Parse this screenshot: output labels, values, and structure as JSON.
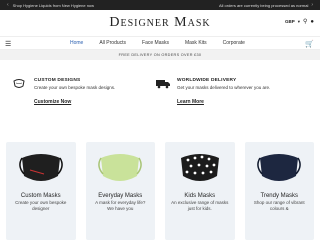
{
  "topbar": {
    "left_text": "Shop Hygiene Liquids from New Hygiene now",
    "right_text": "All orders are currently being processed as normal"
  },
  "header": {
    "logo": "Designer Mask",
    "currency": "GBP"
  },
  "nav": {
    "items": [
      {
        "label": "Home",
        "active": true
      },
      {
        "label": "All Products"
      },
      {
        "label": "Face Masks"
      },
      {
        "label": "Mask Kits"
      },
      {
        "label": "Corporate"
      }
    ]
  },
  "delivery_banner": "FREE DELIVERY ON ORDERS OVER £30",
  "features": [
    {
      "icon": "mask-icon",
      "title": "CUSTOM DESIGNS",
      "desc": "Create your own bespoke mask designs.",
      "link": "Customize Now"
    },
    {
      "icon": "delivery-truck-icon",
      "title": "WORLDWIDE DELIVERY",
      "desc": "Get your masks delivered to wherever you are.",
      "link": "Learn More"
    }
  ],
  "products": [
    {
      "name": "Custom Masks",
      "sub": "Create your own bespoke designer",
      "color": "#1f1f1f"
    },
    {
      "name": "Everyday Masks",
      "sub": "A mask for everyday life? We have you",
      "color": "#c9e29a"
    },
    {
      "name": "Kids Masks",
      "sub": "An exclusive range of masks just for kids.",
      "color": "#1c1c1c"
    },
    {
      "name": "Trendy Masks",
      "sub": "Shop our range of vibrant colours &",
      "color": "#1d2740"
    }
  ]
}
